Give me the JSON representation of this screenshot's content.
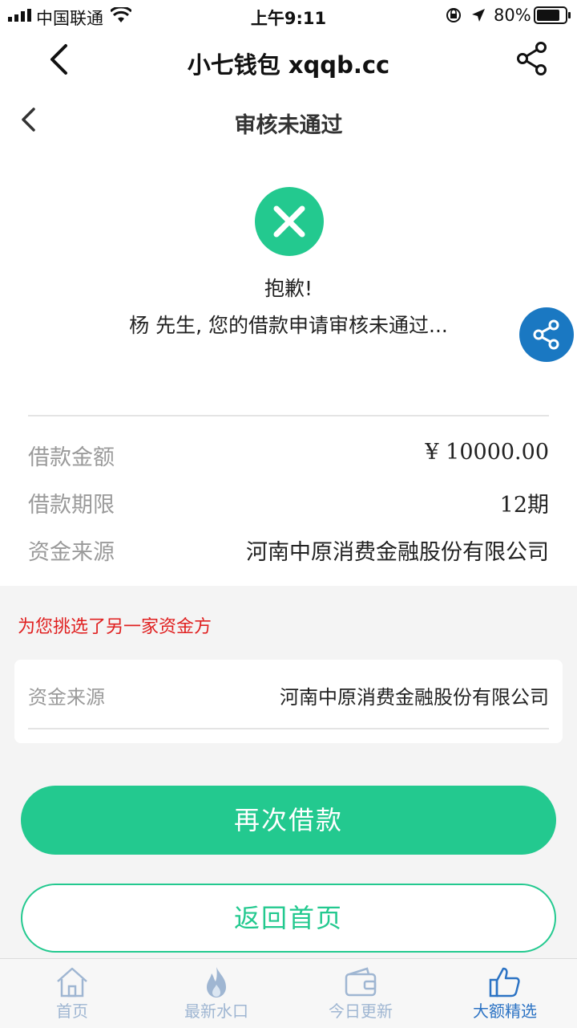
{
  "status_bar": {
    "carrier": "中国联通",
    "time": "上午9:11",
    "battery": "80%"
  },
  "nav": {
    "title": "小七钱包 xqqb.cc"
  },
  "page": {
    "subtitle": "审核未通过",
    "message_line1": "抱歉!",
    "message_line2": "杨 先生, 您的借款申请审核未通过..."
  },
  "details": [
    {
      "label": "借款金额",
      "value": "¥ 10000.00"
    },
    {
      "label": "借款期限",
      "value": "12期"
    },
    {
      "label": "资金来源",
      "value": "河南中原消费金融股份有限公司"
    }
  ],
  "alternative": {
    "notice": "为您挑选了另一家资金方",
    "label": "资金来源",
    "value": "河南中原消费金融股份有限公司"
  },
  "buttons": {
    "primary": "再次借款",
    "secondary": "返回首页"
  },
  "tabs": [
    {
      "label": "首页",
      "icon": "home-icon"
    },
    {
      "label": "最新水口",
      "icon": "fire-icon"
    },
    {
      "label": "今日更新",
      "icon": "wallet-icon"
    },
    {
      "label": "大额精选",
      "icon": "thumbs-up-icon"
    }
  ],
  "colors": {
    "accent": "#23c98f",
    "share_fab": "#1a78c2",
    "notice_red": "#e02020",
    "tab_active": "#2c73c4"
  }
}
